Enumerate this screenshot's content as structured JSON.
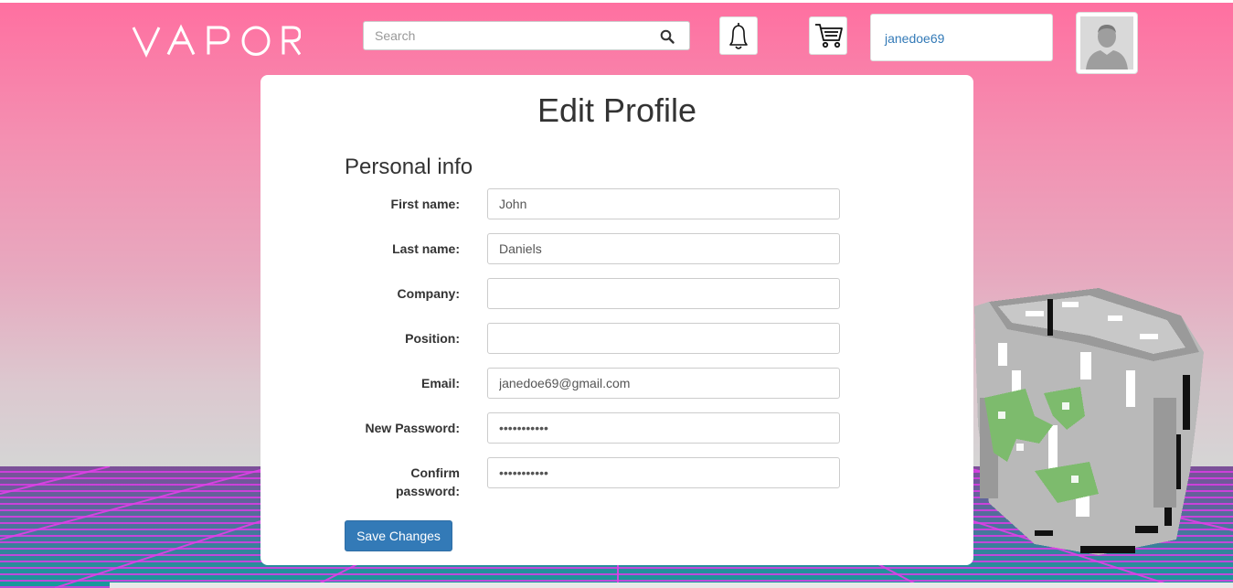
{
  "app": {
    "logo_text": "VAPOR"
  },
  "header": {
    "search_placeholder": "Search",
    "username": "janedoe69"
  },
  "profile": {
    "title": "Edit Profile",
    "section_title": "Personal info",
    "fields": [
      {
        "label": "First name:",
        "value": "John",
        "type": "text"
      },
      {
        "label": "Last name:",
        "value": "Daniels",
        "type": "text"
      },
      {
        "label": "Company:",
        "value": "",
        "type": "text"
      },
      {
        "label": "Position:",
        "value": "",
        "type": "text"
      },
      {
        "label": "Email:",
        "value": "janedoe69@gmail.com",
        "type": "text"
      },
      {
        "label": "New Password:",
        "value": "•••••••••••",
        "type": "password"
      },
      {
        "label": "Confirm password:",
        "value": "•••••••••••",
        "type": "password"
      }
    ],
    "save_label": "Save Changes"
  },
  "icons": {
    "search": "search-icon",
    "notifications": "bell-icon",
    "cart": "cart-icon",
    "avatar": "avatar-icon",
    "decoration": "recycle-bin-icon"
  },
  "colors": {
    "accent": "#337ab7",
    "sky_top": "#ff6fa0",
    "grid_lines": "#dc3ce6",
    "grid_floor": "#169a9c"
  }
}
